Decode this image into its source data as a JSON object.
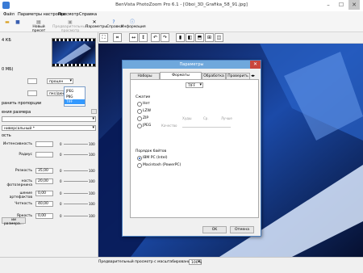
{
  "window": {
    "title": "BenVista PhotoZoom Pro 6.1 - [Oboi_3D_Grafika_58_91.jpg]",
    "minimize": "–",
    "maximize": "☐",
    "close": "✕"
  },
  "menu": [
    "Файл",
    "Параметры настройки",
    "Просмотр",
    "Справка"
  ],
  "toolbar": {
    "new_preset": "Новый пресет",
    "preview": "Предварительный просмотр",
    "parameters": "Параметры",
    "help": "Справка",
    "info": "Информация"
  },
  "left_panel": {
    "file_size": "4 КБ",
    "mb": "0 МБ)",
    "unit1": "процен",
    "unit2": "пкс/дюйм",
    "proportions": "ранить пропорции",
    "size_label": "ения размера",
    "preset": "ниверсальный *",
    "section": "ость",
    "rows": [
      {
        "label": "Интенсивность",
        "value": ""
      },
      {
        "label": "Радиус",
        "value": ""
      },
      {
        "label": "Резкость",
        "value": "35,00"
      },
      {
        "label": "ность фотозернина",
        "value": "20,00"
      },
      {
        "label": "шение артефактов",
        "value": "0,00"
      },
      {
        "label": "Четкость",
        "value": "40,00"
      },
      {
        "label": "Яркость",
        "value": "0,00"
      }
    ],
    "min_label": "0",
    "max_label": "100",
    "resize_button": "ии размера..."
  },
  "dialog": {
    "title": "Параметры",
    "tabs": [
      "Наборы настроек",
      "Форматы изображений",
      "Обработка",
      "Проверить н..."
    ],
    "format_selected": "TIFF",
    "format_options": [
      "JPEG",
      "PNG",
      "TIFF"
    ],
    "compression_label": "Сжатие",
    "compression_options": [
      "Нет",
      "LZW",
      "ZIP",
      "JPEG"
    ],
    "quality_label": "Качество",
    "quality_scale": [
      "Худш",
      "Ср.",
      "Лучше"
    ],
    "byte_order_label": "Порядок байтов",
    "byte_order_options": [
      "IBM PC (Intel)",
      "Macintosh (PowerPC)"
    ],
    "ok": "OK",
    "cancel": "Отмена"
  },
  "status": {
    "text": "Предварительный просмотр с масштабированием",
    "zoom": "100%"
  }
}
